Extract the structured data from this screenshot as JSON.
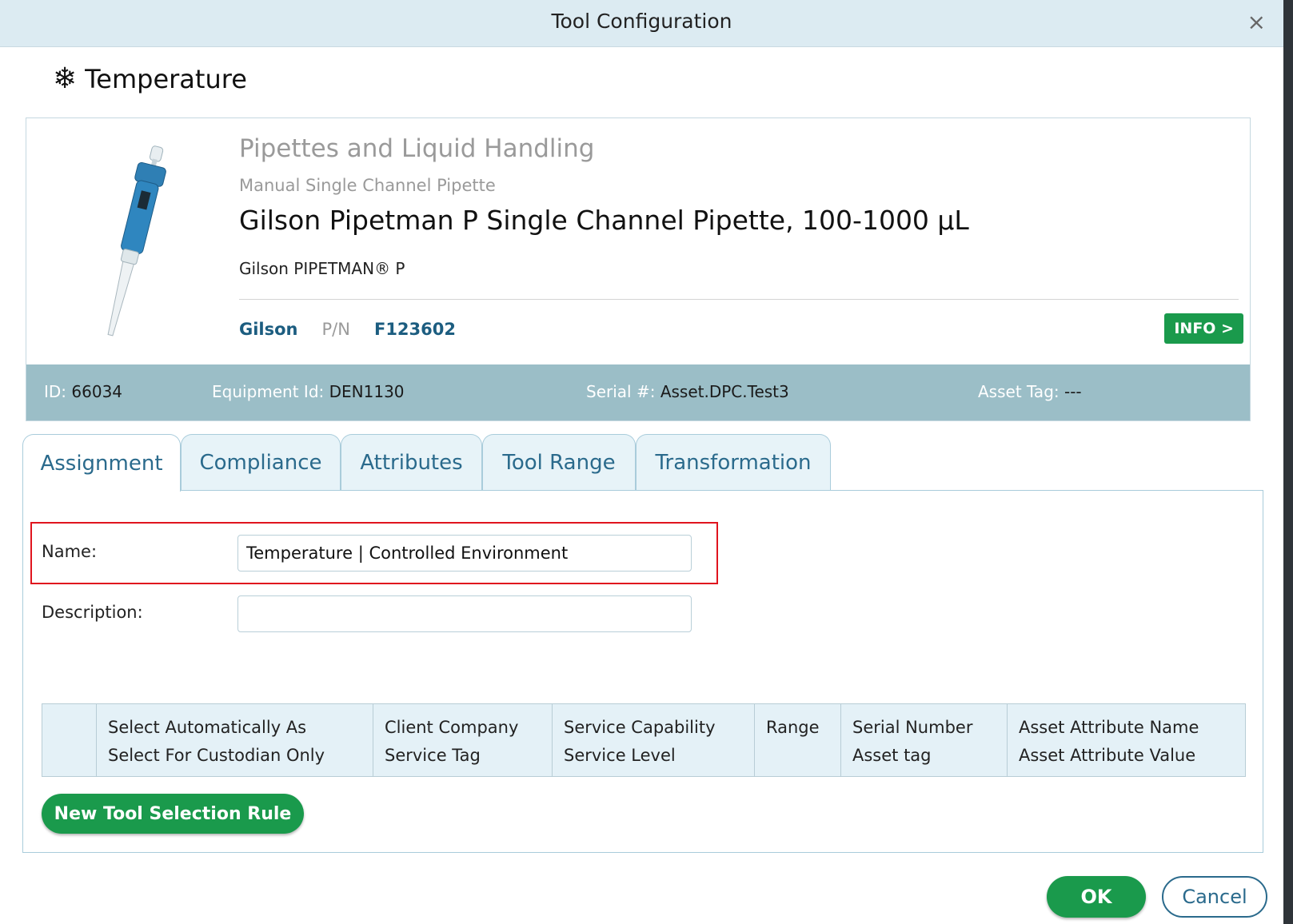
{
  "dialog": {
    "title": "Tool Configuration",
    "close_glyph": "×"
  },
  "heading": {
    "icon": "snowflake-icon",
    "icon_glyph": "❄",
    "text": "Temperature"
  },
  "product": {
    "category": "Pipettes and Liquid Handling",
    "subcategory": "Manual Single Channel Pipette",
    "name": "Gilson Pipetman P Single Channel Pipette, 100-1000 µL",
    "model": "Gilson PIPETMAN® P",
    "manufacturer": "Gilson",
    "pn_label": "P/N",
    "part_number": "F123602",
    "info_button": "INFO >"
  },
  "ids": {
    "id_label": "ID:",
    "id_value": "66034",
    "equipment_label": "Equipment Id:",
    "equipment_value": "DEN1130",
    "serial_label": "Serial #:",
    "serial_value": "Asset.DPC.Test3",
    "asset_label": "Asset Tag:",
    "asset_value": "---"
  },
  "tabs": [
    {
      "label": "Assignment"
    },
    {
      "label": "Compliance"
    },
    {
      "label": "Attributes"
    },
    {
      "label": "Tool Range"
    },
    {
      "label": "Transformation"
    }
  ],
  "form": {
    "name_label": "Name:",
    "name_value": "Temperature | Controlled Environment",
    "description_label": "Description:",
    "description_value": ""
  },
  "rules_table": {
    "columns": [
      {
        "line1": "",
        "line2": ""
      },
      {
        "line1": "Select Automatically As",
        "line2": "Select For Custodian Only"
      },
      {
        "line1": "Client Company",
        "line2": "Service Tag"
      },
      {
        "line1": "Service Capability",
        "line2": "Service Level"
      },
      {
        "line1": "Range",
        "line2": ""
      },
      {
        "line1": "Serial Number",
        "line2": "Asset tag"
      },
      {
        "line1": "Asset Attribute Name",
        "line2": "Asset Attribute Value"
      }
    ],
    "new_rule_button": "New Tool Selection Rule"
  },
  "footer": {
    "ok_label": "OK",
    "cancel_label": "Cancel"
  },
  "colors": {
    "accent_green": "#1a9a4c",
    "link_blue": "#1c5d80",
    "id_bar": "#9bbec7",
    "highlight_red": "#e0141e"
  }
}
